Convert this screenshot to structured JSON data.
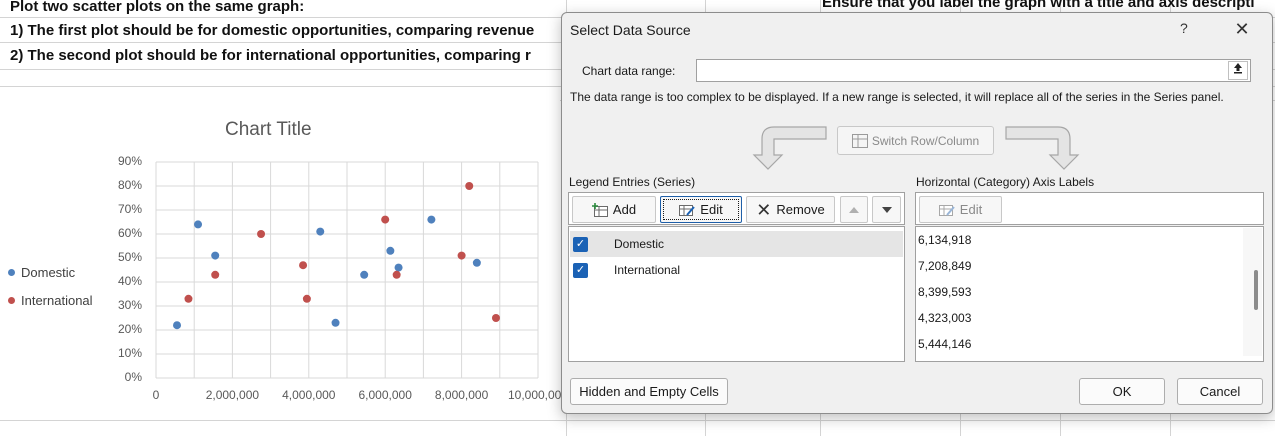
{
  "sheet": {
    "line1": "Plot two scatter plots on the same graph:",
    "line2": "1) The first plot should be for domestic opportunities, comparing revenue",
    "line3": "2) The second plot should be for international opportunities, comparing r",
    "right_note": "Ensure that you label the graph with a title and axis descripti"
  },
  "chart": {
    "title": "Chart Title",
    "legend": [
      {
        "name": "Domestic",
        "color": "#4f81bd"
      },
      {
        "name": "International",
        "color": "#c0504d"
      }
    ],
    "y_ticks": [
      "90%",
      "80%",
      "70%",
      "60%",
      "50%",
      "40%",
      "30%",
      "20%",
      "10%",
      "0%"
    ],
    "x_ticks": [
      "0",
      "2,000,000",
      "4,000,000",
      "6,000,000",
      "8,000,000",
      "10,000,000"
    ]
  },
  "chart_data": {
    "type": "scatter",
    "title": "Chart Title",
    "xlim": [
      0,
      10000000
    ],
    "ylim": [
      0,
      0.9
    ],
    "grid": true,
    "legend_position": "left",
    "series": [
      {
        "name": "Domestic",
        "color": "#4f81bd",
        "points": [
          [
            550000,
            0.22
          ],
          [
            1100000,
            0.64
          ],
          [
            1550000,
            0.51
          ],
          [
            4300000,
            0.61
          ],
          [
            4700000,
            0.23
          ],
          [
            5450000,
            0.43
          ],
          [
            6134918,
            0.53
          ],
          [
            6350000,
            0.46
          ],
          [
            7208849,
            0.66
          ],
          [
            8399593,
            0.48
          ]
        ]
      },
      {
        "name": "International",
        "color": "#c0504d",
        "points": [
          [
            850000,
            0.33
          ],
          [
            1550000,
            0.43
          ],
          [
            2750000,
            0.6
          ],
          [
            3850000,
            0.47
          ],
          [
            3950000,
            0.33
          ],
          [
            6000000,
            0.66
          ],
          [
            6300000,
            0.43
          ],
          [
            8000000,
            0.51
          ],
          [
            8200000,
            0.8
          ],
          [
            8900000,
            0.25
          ]
        ]
      }
    ]
  },
  "dialog": {
    "title": "Select Data Source",
    "help": "?",
    "close": "✕",
    "chart_range_label": "Chart data range:",
    "chart_range_value": "",
    "message": "The data range is too complex to be displayed. If a new range is selected, it will replace all of the series in the Series panel.",
    "switch_label": "Switch Row/Column",
    "legend_label": "Legend Entries (Series)",
    "add_label": "Add",
    "edit_label": "Edit",
    "remove_label": "Remove",
    "series": [
      {
        "name": "Domestic",
        "checked": true,
        "selected": true
      },
      {
        "name": "International",
        "checked": true,
        "selected": false
      }
    ],
    "axis_label": "Horizontal (Category) Axis Labels",
    "axis_edit_label": "Edit",
    "axis_values": [
      "6,134,918",
      "7,208,849",
      "8,399,593",
      "4,323,003",
      "5,444,146"
    ],
    "hidden_cells_label": "Hidden and Empty Cells",
    "ok_label": "OK",
    "cancel_label": "Cancel"
  }
}
